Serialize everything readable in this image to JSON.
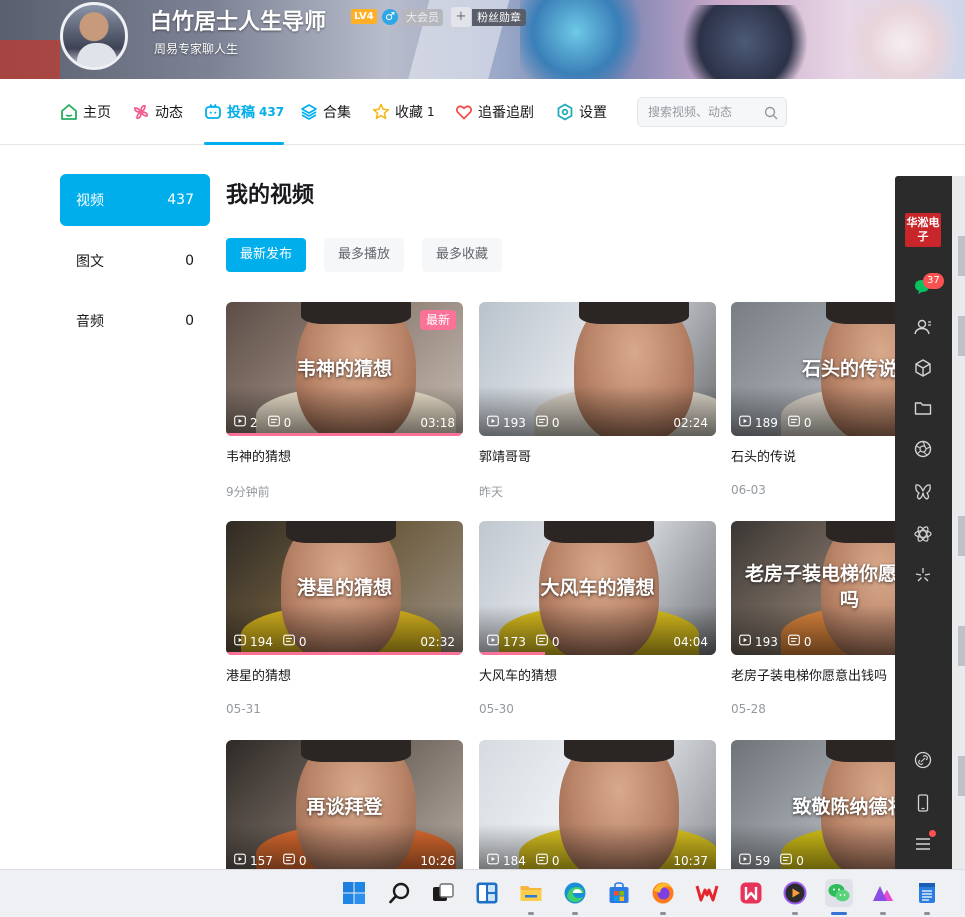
{
  "header": {
    "username": "白竹居士人生导师",
    "level": "LV4",
    "gender_icon": "male-icon",
    "vip_label": "大会员",
    "fans_badge": "粉丝勋章",
    "signature": "周易专家聊人生"
  },
  "nav": {
    "items": [
      {
        "label": "主页",
        "count": "",
        "icon": "home-icon"
      },
      {
        "label": "动态",
        "count": "",
        "icon": "pinwheel-icon"
      },
      {
        "label": "投稿",
        "count": "437",
        "icon": "tv-icon",
        "active": true
      },
      {
        "label": "合集",
        "count": "",
        "icon": "layers-icon"
      },
      {
        "label": "收藏",
        "count": "1",
        "icon": "star-icon"
      },
      {
        "label": "追番追剧",
        "count": "",
        "icon": "heart-icon"
      },
      {
        "label": "设置",
        "count": "",
        "icon": "settings-icon"
      }
    ],
    "search_placeholder": "搜索视频、动态"
  },
  "sidebar": {
    "items": [
      {
        "label": "视频",
        "count": "437",
        "active": true
      },
      {
        "label": "图文",
        "count": "0"
      },
      {
        "label": "音频",
        "count": "0"
      }
    ]
  },
  "main": {
    "title": "我的视频",
    "sort_tabs": [
      {
        "label": "最新发布",
        "active": true
      },
      {
        "label": "最多播放"
      },
      {
        "label": "最多收藏"
      }
    ],
    "videos": [
      {
        "overlay": "韦神的猜想",
        "plays": "2",
        "comments": "0",
        "duration": "03:18",
        "title": "韦神的猜想",
        "date": "9分钟前",
        "tag": "最新",
        "progress": 1.0
      },
      {
        "overlay": "",
        "plays": "193",
        "comments": "0",
        "duration": "02:24",
        "title": "郭靖哥哥",
        "date": "昨天",
        "progress": 0
      },
      {
        "overlay": "石头的传说",
        "plays": "189",
        "comments": "0",
        "duration": "",
        "title": "石头的传说",
        "date": "06-03",
        "progress": 0
      },
      {
        "overlay": "港星的猜想",
        "plays": "194",
        "comments": "0",
        "duration": "02:32",
        "title": "港星的猜想",
        "date": "05-31",
        "progress": 1.0
      },
      {
        "overlay": "大风车的猜想",
        "plays": "173",
        "comments": "0",
        "duration": "04:04",
        "title": "大风车的猜想",
        "date": "05-30",
        "progress": 0.28
      },
      {
        "overlay": "老房子装电梯你愿意出钱吗",
        "plays": "193",
        "comments": "0",
        "duration": "",
        "title": "老房子装电梯你愿意出钱吗",
        "date": "05-28",
        "progress": 0
      },
      {
        "overlay": "再谈拜登",
        "plays": "157",
        "comments": "0",
        "duration": "10:26",
        "title": "",
        "date": "",
        "progress": 0
      },
      {
        "overlay": "",
        "plays": "184",
        "comments": "0",
        "duration": "10:37",
        "title": "",
        "date": "",
        "progress": 0
      },
      {
        "overlay": "致敬陈纳德将",
        "plays": "59",
        "comments": "0",
        "duration": "",
        "title": "",
        "date": "",
        "progress": 0
      }
    ]
  },
  "right_sidebar": {
    "app_logo_text": "华淞电子",
    "chat_badge": "37",
    "icons": [
      "chat-icon",
      "contacts-icon",
      "cube-icon",
      "folder-icon",
      "aperture-icon",
      "butterfly-icon",
      "atom-icon",
      "sparkle-icon",
      "link-icon",
      "phone-icon",
      "menu-icon"
    ]
  },
  "taskbar": {
    "apps": [
      "windows-start-icon",
      "search-icon",
      "task-view-icon",
      "widgets-icon",
      "file-explorer-icon",
      "edge-icon",
      "store-icon",
      "firefox-icon",
      "wps-icon",
      "kingsoft-icon",
      "media-player-icon",
      "wechat-icon",
      "aurora-icon",
      "notepad-icon"
    ]
  },
  "colors": {
    "accent": "#00aeec",
    "pink": "#fb7299",
    "sidebar_dark": "#2b2b2b"
  }
}
